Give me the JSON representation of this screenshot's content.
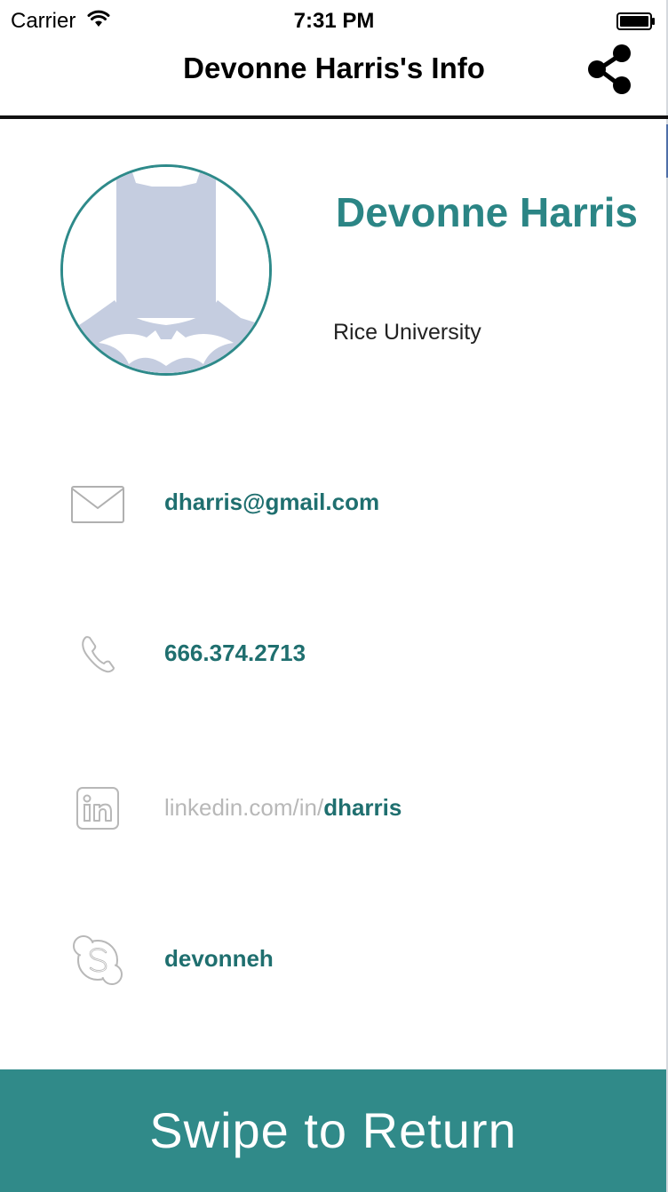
{
  "status_bar": {
    "carrier": "Carrier",
    "time": "7:31 PM",
    "icons": [
      "wifi-icon",
      "battery-icon"
    ]
  },
  "nav": {
    "title": "Devonne Harris's Info",
    "share_icon": "share-icon"
  },
  "profile": {
    "name": "Devonne Harris",
    "organization": "Rice University",
    "avatar_icon": "batman-silhouette-avatar"
  },
  "contacts": [
    {
      "type": "email",
      "icon": "envelope-icon",
      "value": "dharris@gmail.com"
    },
    {
      "type": "phone",
      "icon": "phone-icon",
      "value": "666.374.2713"
    },
    {
      "type": "linkedin",
      "icon": "linkedin-icon",
      "prefix": "linkedin.com/in/",
      "value": "dharris"
    },
    {
      "type": "skype",
      "icon": "skype-icon",
      "value": "devonneh"
    }
  ],
  "footer": {
    "label": "Swipe to Return"
  },
  "colors": {
    "accent": "#308a89",
    "name_text": "#2b8585",
    "contact_text": "#1f6f6f",
    "muted_text": "#b8b8b8",
    "avatar_fill": "#c5cde0"
  }
}
